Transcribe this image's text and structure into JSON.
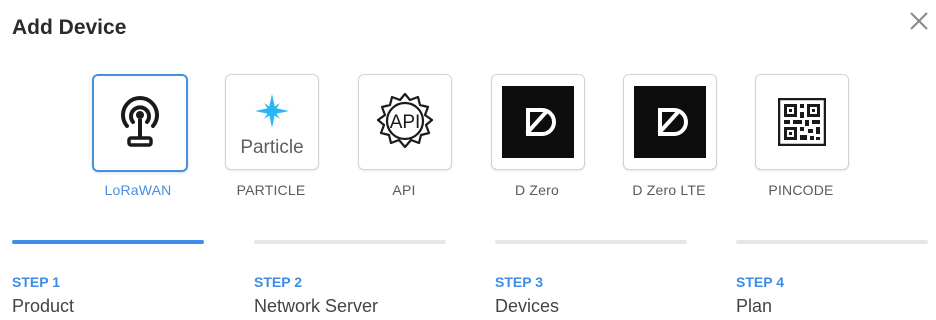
{
  "dialog": {
    "title": "Add Device",
    "close_icon": "close-icon"
  },
  "colors": {
    "accent": "#3f8ce8",
    "selected_border": "#4a90d9",
    "tile_border": "#d4d4d4",
    "dzero_bg": "#0d0d0d"
  },
  "devices": [
    {
      "label": "LoRaWAN",
      "icon": "antenna-icon",
      "selected": true
    },
    {
      "label": "PARTICLE",
      "icon": "particle-logo-icon",
      "logo_text": "Particle",
      "selected": false
    },
    {
      "label": "API",
      "icon": "api-gear-icon",
      "logo_text": "API",
      "selected": false
    },
    {
      "label": "D Zero",
      "icon": "d-zero-logo-icon",
      "selected": false
    },
    {
      "label": "D Zero LTE",
      "icon": "d-zero-logo-icon",
      "selected": false
    },
    {
      "label": "PINCODE",
      "icon": "qr-code-icon",
      "selected": false
    }
  ],
  "steps": [
    {
      "number": "STEP 1",
      "name": "Product",
      "progress": 1.0
    },
    {
      "number": "STEP 2",
      "name": "Network Server",
      "progress": 0
    },
    {
      "number": "STEP 3",
      "name": "Devices",
      "progress": 0
    },
    {
      "number": "STEP 4",
      "name": "Plan",
      "progress": 0
    }
  ]
}
